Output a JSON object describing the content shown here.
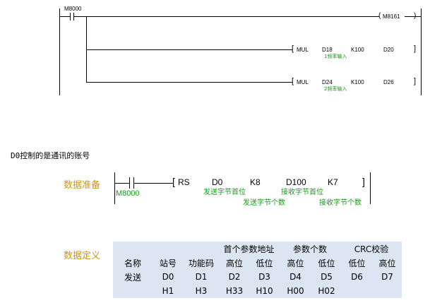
{
  "ladder": {
    "contact": "M8000",
    "coil": "M8161",
    "mul1": {
      "op": "MUL",
      "src": "D18",
      "k": "K100",
      "dst": "D20",
      "comment": "1频率输入"
    },
    "mul2": {
      "op": "MUL",
      "src": "D24",
      "k": "K100",
      "dst": "D26",
      "comment": "2频率输入"
    }
  },
  "note": "D0控制的是通讯的账号",
  "prep": {
    "label": "数据准备",
    "contact": "M8000",
    "instr": "RS",
    "p1": "D0",
    "p2": "K8",
    "p3": "D100",
    "p4": "K7",
    "c1": "发送字节首位",
    "c2": "发送字节个数",
    "c3": "接收字节首位",
    "c4": "接收字节个数"
  },
  "definition": {
    "label": "数据定义",
    "group_headers": [
      "首个参数地址",
      "参数个数",
      "CRC校验"
    ],
    "row_titles": [
      "名称",
      "站号",
      "功能码",
      "高位",
      "低位",
      "高位",
      "低位",
      "低位",
      "高位"
    ],
    "row_send": [
      "发送",
      "D0",
      "D1",
      "D2",
      "D3",
      "D4",
      "D5",
      "D6",
      "D7"
    ],
    "row_values": [
      "",
      "H1",
      "H3",
      "H33",
      "H10",
      "H00",
      "H02",
      "",
      ""
    ]
  }
}
